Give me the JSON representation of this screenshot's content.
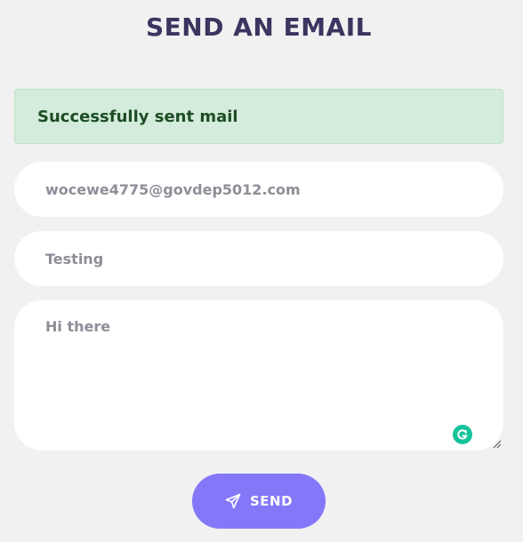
{
  "header": {
    "title": "SEND AN EMAIL"
  },
  "alert": {
    "message": "Successfully sent mail",
    "color": "#d4ecdb"
  },
  "form": {
    "email_value": "wocewe4775@govdep5012.com",
    "subject_value": "Testing",
    "message_value": "Hi there",
    "send_label": "SEND",
    "send_icon": "paper-plane-icon",
    "grammarly_icon": "grammarly-icon",
    "accent_color": "#8478f9"
  }
}
